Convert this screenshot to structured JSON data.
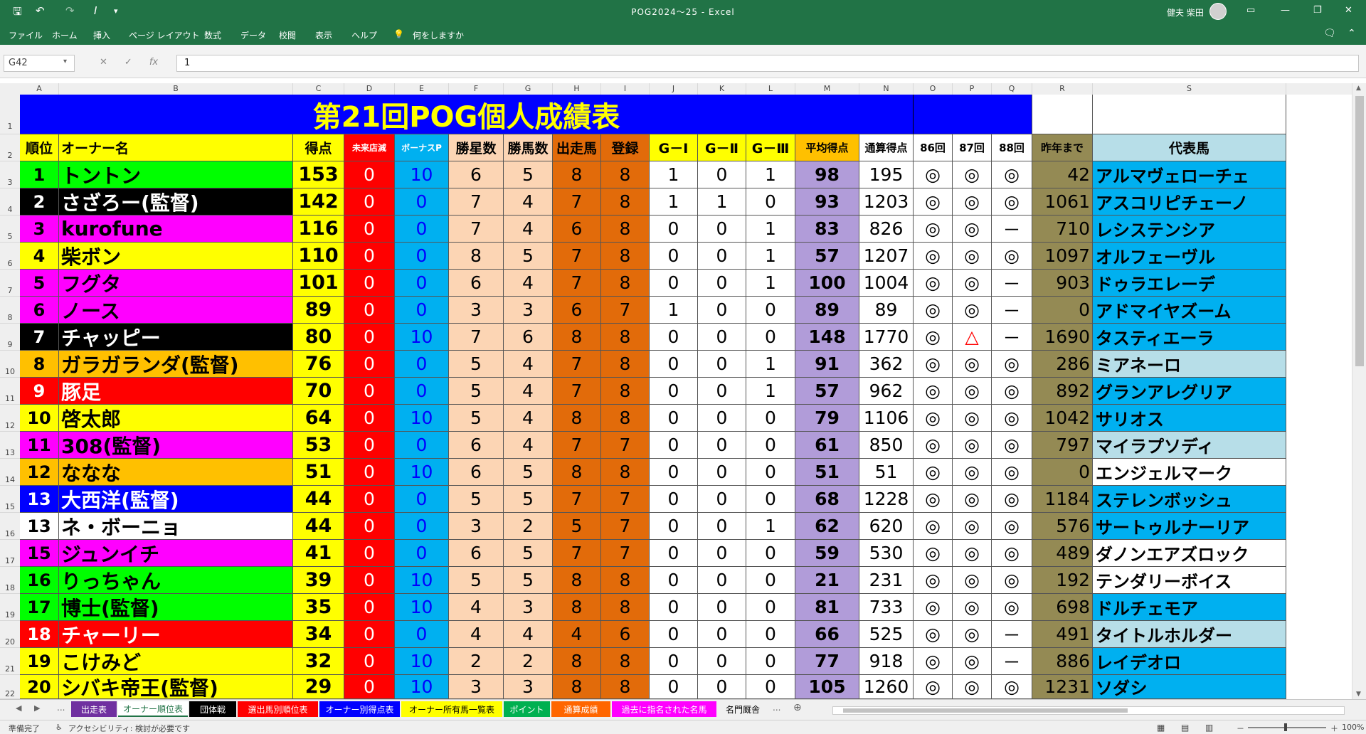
{
  "window": {
    "title": "POG2024～25  -  Excel",
    "user": "健夫 柴田"
  },
  "ribbon_tabs": [
    "ファイル",
    "ホーム",
    "挿入",
    "ページ レイアウト",
    "数式",
    "データ",
    "校閲",
    "表示",
    "ヘルプ",
    "何をしますか"
  ],
  "formula_bar": {
    "name_box": "G42",
    "value": "1"
  },
  "columns": [
    "A",
    "B",
    "C",
    "D",
    "E",
    "F",
    "G",
    "H",
    "I",
    "J",
    "K",
    "L",
    "M",
    "N",
    "O",
    "P",
    "Q",
    "R",
    "S"
  ],
  "title": "第21回POG個人成績表",
  "headers": [
    "順位",
    "オーナー名",
    "得点",
    "未来店減",
    "ボーナスP",
    "勝星数",
    "勝馬数",
    "出走馬",
    "登録",
    "G－Ⅰ",
    "G－Ⅱ",
    "G－Ⅲ",
    "平均得点",
    "通算得点",
    "86回",
    "87回",
    "88回",
    "昨年まで",
    "代表馬"
  ],
  "rows": [
    [
      "1",
      "トントン",
      "153",
      "0",
      "10",
      "6",
      "5",
      "8",
      "8",
      "1",
      "0",
      "1",
      "98",
      "195",
      "◎",
      "◎",
      "◎",
      "42",
      "アルマヴェローチェ"
    ],
    [
      "2",
      "さざろー(監督)",
      "142",
      "0",
      "0",
      "7",
      "4",
      "7",
      "8",
      "1",
      "1",
      "0",
      "93",
      "1203",
      "◎",
      "◎",
      "◎",
      "1061",
      "アスコリピチェーノ"
    ],
    [
      "3",
      "kurofune",
      "116",
      "0",
      "0",
      "7",
      "4",
      "6",
      "8",
      "0",
      "0",
      "1",
      "83",
      "826",
      "◎",
      "◎",
      "－",
      "710",
      "レシステンシア"
    ],
    [
      "4",
      "柴ボン",
      "110",
      "0",
      "0",
      "8",
      "5",
      "7",
      "8",
      "0",
      "0",
      "1",
      "57",
      "1207",
      "◎",
      "◎",
      "◎",
      "1097",
      "オルフェーヴル"
    ],
    [
      "5",
      "フグタ",
      "101",
      "0",
      "0",
      "6",
      "4",
      "7",
      "8",
      "0",
      "0",
      "1",
      "100",
      "1004",
      "◎",
      "◎",
      "－",
      "903",
      "ドゥラエレーデ"
    ],
    [
      "6",
      "ノース",
      "89",
      "0",
      "0",
      "3",
      "3",
      "6",
      "7",
      "1",
      "0",
      "0",
      "89",
      "89",
      "◎",
      "◎",
      "－",
      "0",
      "アドマイヤズーム"
    ],
    [
      "7",
      "チャッピー",
      "80",
      "0",
      "10",
      "7",
      "6",
      "8",
      "8",
      "0",
      "0",
      "0",
      "148",
      "1770",
      "◎",
      "△",
      "－",
      "1690",
      "タスティエーラ"
    ],
    [
      "8",
      "ガラガランダ(監督)",
      "76",
      "0",
      "0",
      "5",
      "4",
      "7",
      "8",
      "0",
      "0",
      "1",
      "91",
      "362",
      "◎",
      "◎",
      "◎",
      "286",
      "ミアネーロ"
    ],
    [
      "9",
      "豚足",
      "70",
      "0",
      "0",
      "5",
      "4",
      "7",
      "8",
      "0",
      "0",
      "1",
      "57",
      "962",
      "◎",
      "◎",
      "◎",
      "892",
      "グランアレグリア"
    ],
    [
      "10",
      "啓太郎",
      "64",
      "0",
      "10",
      "5",
      "4",
      "8",
      "8",
      "0",
      "0",
      "0",
      "79",
      "1106",
      "◎",
      "◎",
      "◎",
      "1042",
      "サリオス"
    ],
    [
      "11",
      "308(監督)",
      "53",
      "0",
      "0",
      "6",
      "4",
      "7",
      "7",
      "0",
      "0",
      "0",
      "61",
      "850",
      "◎",
      "◎",
      "◎",
      "797",
      "マイラプソディ"
    ],
    [
      "12",
      "ななな",
      "51",
      "0",
      "10",
      "6",
      "5",
      "8",
      "8",
      "0",
      "0",
      "0",
      "51",
      "51",
      "◎",
      "◎",
      "◎",
      "0",
      "エンジェルマーク"
    ],
    [
      "13",
      "大西洋(監督)",
      "44",
      "0",
      "0",
      "5",
      "5",
      "7",
      "7",
      "0",
      "0",
      "0",
      "68",
      "1228",
      "◎",
      "◎",
      "◎",
      "1184",
      "ステレンボッシュ"
    ],
    [
      "13",
      "ネ・ボーニョ",
      "44",
      "0",
      "0",
      "3",
      "2",
      "5",
      "7",
      "0",
      "0",
      "1",
      "62",
      "620",
      "◎",
      "◎",
      "◎",
      "576",
      "サートゥルナーリア"
    ],
    [
      "15",
      "ジュンイチ",
      "41",
      "0",
      "0",
      "6",
      "5",
      "7",
      "7",
      "0",
      "0",
      "0",
      "59",
      "530",
      "◎",
      "◎",
      "◎",
      "489",
      "ダノンエアズロック"
    ],
    [
      "16",
      "りっちゃん",
      "39",
      "0",
      "10",
      "5",
      "5",
      "8",
      "8",
      "0",
      "0",
      "0",
      "21",
      "231",
      "◎",
      "◎",
      "◎",
      "192",
      "テンダリーボイス"
    ],
    [
      "17",
      "博士(監督)",
      "35",
      "0",
      "10",
      "4",
      "3",
      "8",
      "8",
      "0",
      "0",
      "0",
      "81",
      "733",
      "◎",
      "◎",
      "◎",
      "698",
      "ドルチェモア"
    ],
    [
      "18",
      "チャーリー",
      "34",
      "0",
      "0",
      "4",
      "4",
      "4",
      "6",
      "0",
      "0",
      "0",
      "66",
      "525",
      "◎",
      "◎",
      "－",
      "491",
      "タイトルホルダー"
    ],
    [
      "19",
      "こけみど",
      "32",
      "0",
      "10",
      "2",
      "2",
      "8",
      "8",
      "0",
      "0",
      "0",
      "77",
      "918",
      "◎",
      "◎",
      "－",
      "886",
      "レイデオロ"
    ],
    [
      "20",
      "シバキ帝王(監督)",
      "29",
      "0",
      "10",
      "3",
      "3",
      "8",
      "8",
      "0",
      "0",
      "0",
      "105",
      "1260",
      "◎",
      "◎",
      "◎",
      "1231",
      "ソダシ"
    ]
  ],
  "name_colors": [
    {
      "bg": "#00ff00",
      "fg": "#000"
    },
    {
      "bg": "#000000",
      "fg": "#fff"
    },
    {
      "bg": "#ff00ff",
      "fg": "#000"
    },
    {
      "bg": "#ffff00",
      "fg": "#000"
    },
    {
      "bg": "#ff00ff",
      "fg": "#000"
    },
    {
      "bg": "#ff00ff",
      "fg": "#000"
    },
    {
      "bg": "#000000",
      "fg": "#fff"
    },
    {
      "bg": "#ffc000",
      "fg": "#000"
    },
    {
      "bg": "#ff0000",
      "fg": "#fff"
    },
    {
      "bg": "#ffff00",
      "fg": "#000"
    },
    {
      "bg": "#ff00ff",
      "fg": "#000"
    },
    {
      "bg": "#ffc000",
      "fg": "#000"
    },
    {
      "bg": "#0000ff",
      "fg": "#fff"
    },
    {
      "bg": "#ffffff",
      "fg": "#000"
    },
    {
      "bg": "#ff00ff",
      "fg": "#000"
    },
    {
      "bg": "#00ff00",
      "fg": "#000"
    },
    {
      "bg": "#00ff00",
      "fg": "#000"
    },
    {
      "bg": "#ff0000",
      "fg": "#fff"
    },
    {
      "bg": "#ffff00",
      "fg": "#000"
    },
    {
      "bg": "#ffff00",
      "fg": "#000"
    }
  ],
  "rep_colors": [
    "#00b0f0",
    "#00b0f0",
    "#00b0f0",
    "#00b0f0",
    "#00b0f0",
    "#00b0f0",
    "#00b0f0",
    "#b7dee8",
    "#00b0f0",
    "#00b0f0",
    "#b7dee8",
    "#ffffff",
    "#00b0f0",
    "#00b0f0",
    "#ffffff",
    "#ffffff",
    "#00b0f0",
    "#b7dee8",
    "#00b0f0",
    "#00b0f0"
  ],
  "sheet_tabs": [
    {
      "label": "出走表",
      "bg": "#7030a0",
      "fg": "#fff"
    },
    {
      "label": "オーナー順位表",
      "bg": "#ffffff",
      "fg": "#217346"
    },
    {
      "label": "団体戦",
      "bg": "#000000",
      "fg": "#fff"
    },
    {
      "label": "選出馬別順位表",
      "bg": "#ff0000",
      "fg": "#fff"
    },
    {
      "label": "オーナー別得点表",
      "bg": "#0000ff",
      "fg": "#fff"
    },
    {
      "label": "オーナー所有馬一覧表",
      "bg": "#ffff00",
      "fg": "#000"
    },
    {
      "label": "ポイント",
      "bg": "#00b050",
      "fg": "#fff"
    },
    {
      "label": "通算成績",
      "bg": "#ff6600",
      "fg": "#fff"
    },
    {
      "label": "過去に指名された名馬",
      "bg": "#ff00ff",
      "fg": "#fff"
    },
    {
      "label": "名門厩舎",
      "bg": "#f0f0f0",
      "fg": "#000"
    }
  ],
  "status": {
    "ready": "準備完了",
    "accessibility": "アクセシビリティ: 検討が必要です",
    "zoom": "100%"
  }
}
